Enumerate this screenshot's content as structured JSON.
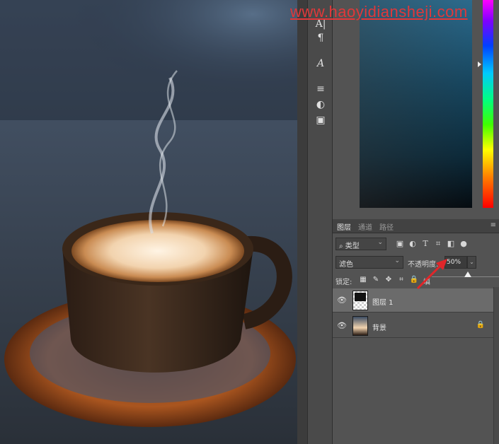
{
  "watermark": "www.haoyidiansheji.com",
  "tools": [
    {
      "icon": "character-panel-icon",
      "glyph": "A|"
    },
    {
      "icon": "paragraph-icon",
      "glyph": "¶"
    },
    {
      "icon": "glyph-icon",
      "glyph": "A"
    },
    {
      "icon": "adjustments-icon",
      "glyph": "≡"
    },
    {
      "icon": "styles-icon",
      "glyph": "◐"
    },
    {
      "icon": "libraries-icon",
      "glyph": "▣"
    }
  ],
  "layers_panel": {
    "tabs": [
      {
        "label": "图层",
        "active": true
      },
      {
        "label": "通道",
        "active": false
      },
      {
        "label": "路径",
        "active": false
      }
    ],
    "filter": {
      "value": "类型"
    },
    "blend_mode": {
      "value": "滤色"
    },
    "opacity": {
      "label": "不透明度:",
      "value": "50%"
    },
    "lock": {
      "label": "锁定:",
      "fill_label": "填"
    },
    "layers": [
      {
        "name": "图层 1",
        "selected": true,
        "locked": false
      },
      {
        "name": "背景",
        "selected": false,
        "locked": true
      }
    ]
  },
  "colors": {
    "panel_bg": "#535353",
    "selected_layer": "#6b6b6b",
    "annotation_arrow": "#e0262a",
    "watermark": "#e0383a"
  }
}
